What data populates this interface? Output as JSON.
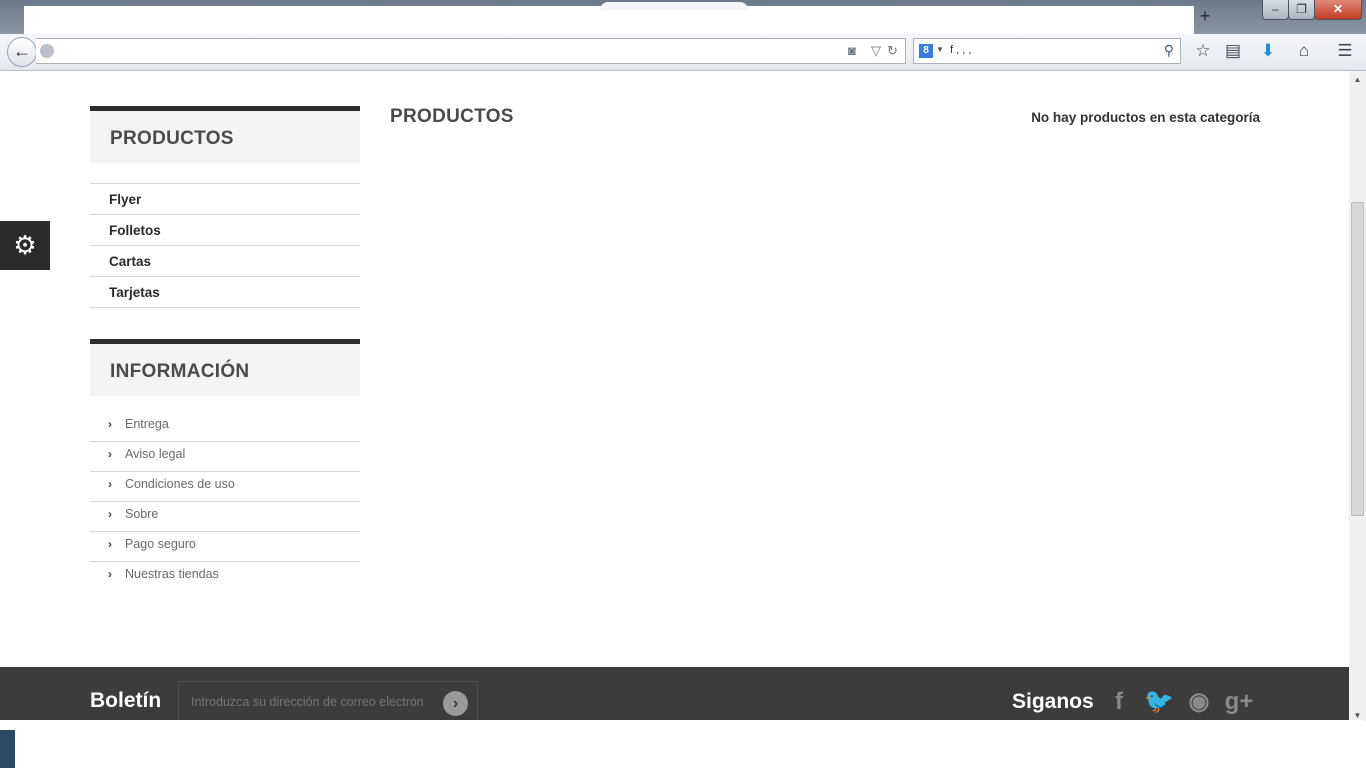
{
  "browser": {
    "new_tab": "+",
    "window_controls": {
      "minimize": "▭",
      "maximize": "❐",
      "close": "✕"
    },
    "back": "←",
    "search_engine_icon": "8",
    "search_text": "f    ,          ,   ,",
    "icons": [
      "star-icon",
      "reading-list-icon",
      "download-icon",
      "home-icon",
      "menu-icon"
    ]
  },
  "sidebar": {
    "categories": {
      "title": "PRODUCTOS",
      "items": [
        {
          "label": "Flyer"
        },
        {
          "label": "Folletos"
        },
        {
          "label": "Cartas"
        },
        {
          "label": "Tarjetas"
        }
      ]
    },
    "information": {
      "title": "INFORMACIÓN",
      "items": [
        {
          "label": "Entrega"
        },
        {
          "label": "Aviso legal"
        },
        {
          "label": "Condiciones de uso"
        },
        {
          "label": "Sobre"
        },
        {
          "label": "Pago seguro"
        },
        {
          "label": "Nuestras tiendas"
        }
      ]
    }
  },
  "main": {
    "title": "PRODUCTOS",
    "empty_message": "No hay productos en esta categoría"
  },
  "footer": {
    "newsletter_label": "Boletín",
    "newsletter_placeholder": "Introduzca su dirección de correo electrón",
    "follow_label": "Siganos",
    "social": [
      "facebook-icon",
      "twitter-icon",
      "rss-icon",
      "google-plus-icon"
    ]
  },
  "colors": {
    "dark": "#2d2d2d",
    "footer_bg": "#3c3c3c",
    "block_bg": "#f4f4f4"
  }
}
